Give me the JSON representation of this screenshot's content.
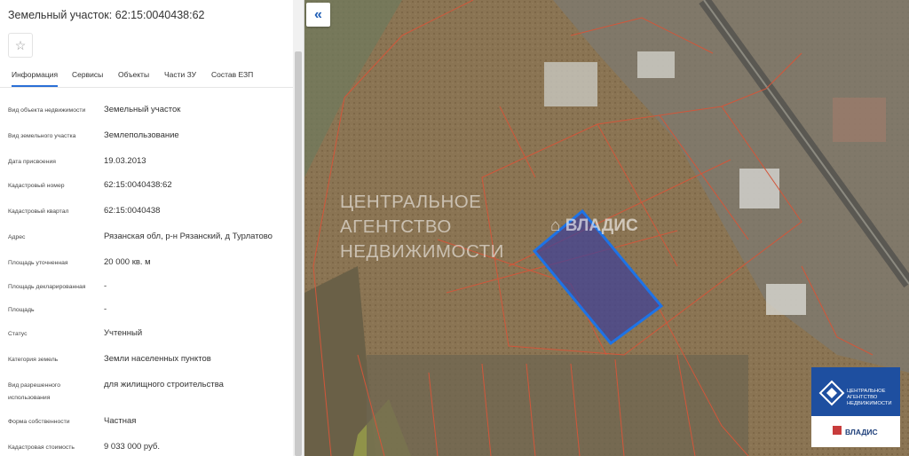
{
  "panel": {
    "title": "Земельный участок: 62:15:0040438:62",
    "favorite_icon": "☆",
    "tabs": [
      "Информация",
      "Сервисы",
      "Объекты",
      "Части ЗУ",
      "Состав ЕЗП"
    ],
    "active_tab": "Информация",
    "rows": [
      {
        "key": "Вид объекта недвижимости",
        "value": "Земельный участок"
      },
      {
        "key": "Вид земельного участка",
        "value": "Землепользование"
      },
      {
        "key": "Дата присвоения",
        "value": "19.03.2013"
      },
      {
        "key": "Кадастровый номер",
        "value": "62:15:0040438:62"
      },
      {
        "key": "Кадастровый квартал",
        "value": "62:15:0040438"
      },
      {
        "key": "Адрес",
        "value": "Рязанская обл, р-н Рязанский, д Турлатово"
      },
      {
        "key": "Площадь уточненная",
        "value": "20 000 кв. м"
      },
      {
        "key": "Площадь декларированная",
        "value": "-"
      },
      {
        "key": "Площадь",
        "value": "-"
      },
      {
        "key": "Статус",
        "value": "Учтенный"
      },
      {
        "key": "Категория земель",
        "value": "Земли населенных пунктов"
      },
      {
        "key": "Вид разрешенного использования",
        "value": "для жилищного строительства"
      },
      {
        "key": "Форма собственности",
        "value": "Частная"
      },
      {
        "key": "Кадастровая стоимость",
        "value": "9 033 000 руб."
      }
    ]
  },
  "map": {
    "collapse_icon": "«",
    "watermark_lines": [
      "ЦЕНТРАЛЬНОЕ",
      "АГЕНТСТВО",
      "НЕДВИЖИМОСТИ"
    ],
    "watermark_brand": "ВЛАДИС",
    "logo_lines": [
      "ЦЕНТРАЛЬНОЕ",
      "АГЕНТСТВО",
      "НЕДВИЖИМОСТИ"
    ],
    "logo_brand": "ВЛАДИС",
    "colors": {
      "parcel_highlight": "#1e73e6",
      "parcel_fill": "#3c3f9a",
      "boundary": "#d2563a",
      "logo_blue": "#1e4fa0"
    }
  }
}
